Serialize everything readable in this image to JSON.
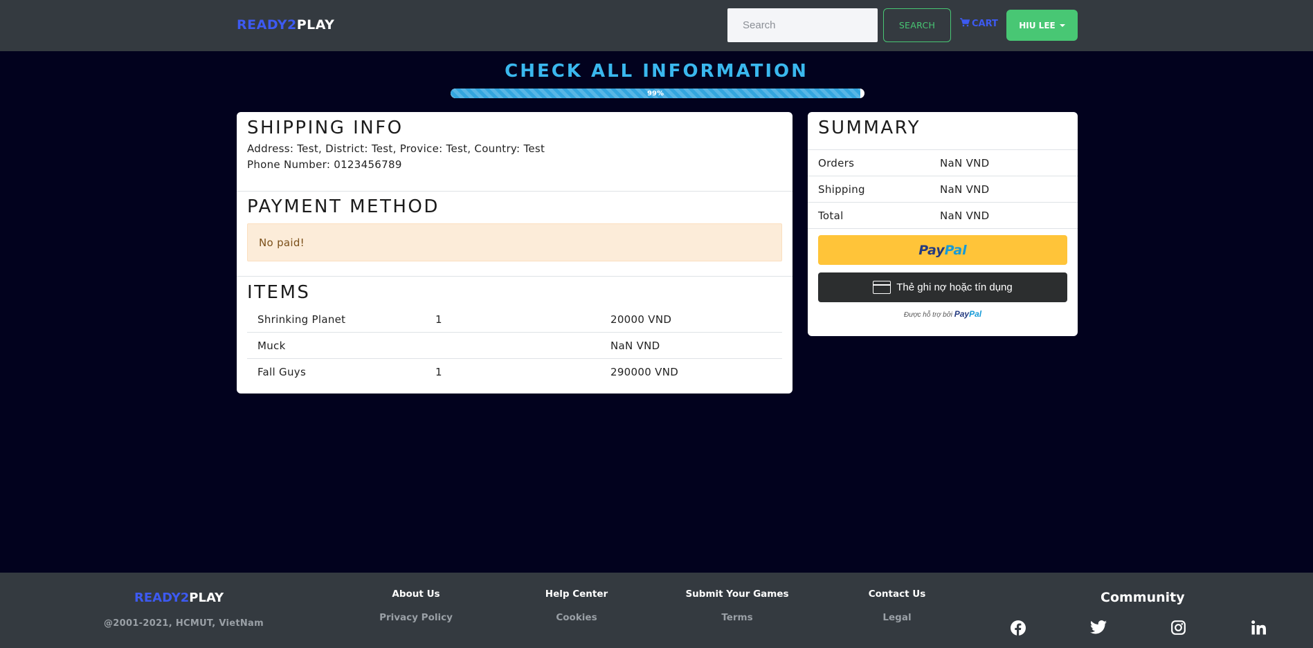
{
  "header": {
    "brand_part1": "READY2",
    "brand_part2": "PLAY",
    "search_placeholder": "Search",
    "search_button": "SEARCH",
    "cart_label": "CART",
    "user_label": "HIU LEE"
  },
  "checkout": {
    "heading": "CHECK ALL INFORMATION",
    "progress_value": 0.99,
    "progress_label": "99%"
  },
  "shipping": {
    "title": "SHIPPING INFO",
    "address": "Address: Test, District: Test, Provice: Test, Country: Test",
    "phone": "Phone Number: 0123456789"
  },
  "payment": {
    "title": "PAYMENT METHOD",
    "status": "No paid!"
  },
  "items": {
    "title": "ITEMS",
    "rows": [
      {
        "name": "Shrinking Planet",
        "qty": "1",
        "price": "20000 VND"
      },
      {
        "name": "Muck",
        "qty": "",
        "price": "NaN VND"
      },
      {
        "name": "Fall Guys",
        "qty": "1",
        "price": "290000 VND"
      }
    ]
  },
  "summary": {
    "title": "SUMMARY",
    "orders_label": "Orders",
    "orders_value": "NaN VND",
    "shipping_label": "Shipping",
    "shipping_value": "NaN VND",
    "total_label": "Total",
    "total_value": "NaN VND",
    "paypal_pay": "Pay",
    "paypal_pal": "Pal",
    "card_button": "Thẻ ghi nợ hoặc tín dụng",
    "powered_by": "Được hỗ trợ bởi",
    "powered_brand_pay": "Pay",
    "powered_brand_pal": "Pal"
  },
  "footer": {
    "brand_part1": "READY2",
    "brand_part2": "PLAY",
    "copyright": "@2001-2021, HCMUT, VietNam",
    "links": [
      {
        "heading": "About Us",
        "sub": "Privacy Policy"
      },
      {
        "heading": "Help Center",
        "sub": "Cookies"
      },
      {
        "heading": "Submit Your Games",
        "sub": "Terms"
      },
      {
        "heading": "Contact Us",
        "sub": "Legal"
      }
    ],
    "community": "Community",
    "social_icons": [
      "facebook-icon",
      "twitter-icon",
      "instagram-icon",
      "linkedin-icon"
    ]
  },
  "colors": {
    "page_background": "#02021e",
    "navbar": "#343a40",
    "brand_blue": "#3d5af1",
    "green": "#48c774",
    "heading_cyan": "#3ab8ee",
    "paypal_yellow": "#ffc439"
  }
}
